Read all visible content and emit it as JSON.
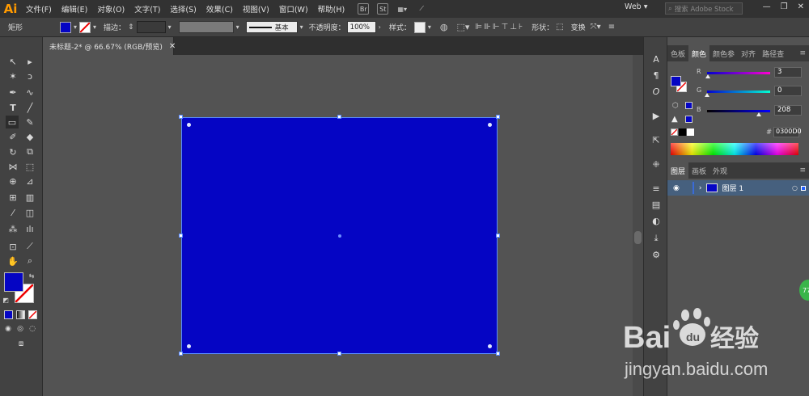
{
  "app": {
    "logo": "Ai",
    "workspace": "Web",
    "stock_search_placeholder": "搜索 Adobe Stock"
  },
  "menu": [
    "文件(F)",
    "编辑(E)",
    "对象(O)",
    "文字(T)",
    "选择(S)",
    "效果(C)",
    "视图(V)",
    "窗口(W)",
    "帮助(H)"
  ],
  "menu_icons": {
    "bridge": "Br",
    "stock": "St"
  },
  "control_bar": {
    "object_type": "矩形",
    "stroke_label": "描边：",
    "stroke_style": "基本",
    "opacity_label": "不透明度：",
    "opacity_value": "100%",
    "style_label": "样式：",
    "shape_label": "形状：",
    "transform_label": "变换",
    "fill_color": "#0505c4"
  },
  "document_tab": {
    "title": "未标题-2* @ 66.67% (RGB/预览)"
  },
  "artboard": {
    "fill_color": "#0505c4"
  },
  "color_panel": {
    "tabs": [
      "色板",
      "颜色",
      "颜色参",
      "对齐",
      "路径查"
    ],
    "active_tab": "颜色",
    "r": {
      "label": "R",
      "value": "3",
      "fraction": 0.012
    },
    "g": {
      "label": "G",
      "value": "0",
      "fraction": 0.0
    },
    "b": {
      "label": "B",
      "value": "208",
      "fraction": 0.816
    },
    "hex_symbol": "#",
    "hex": "0300D0"
  },
  "layers_panel": {
    "tabs": [
      "图层",
      "画板",
      "外观"
    ],
    "active_tab": "图层",
    "layers": [
      {
        "name": "图层 1"
      }
    ]
  },
  "watermark": {
    "brand": "Bai",
    "brand_suffix": "du",
    "tagline": "经验",
    "url": "jingyan.baidu.com"
  },
  "badge": "77"
}
